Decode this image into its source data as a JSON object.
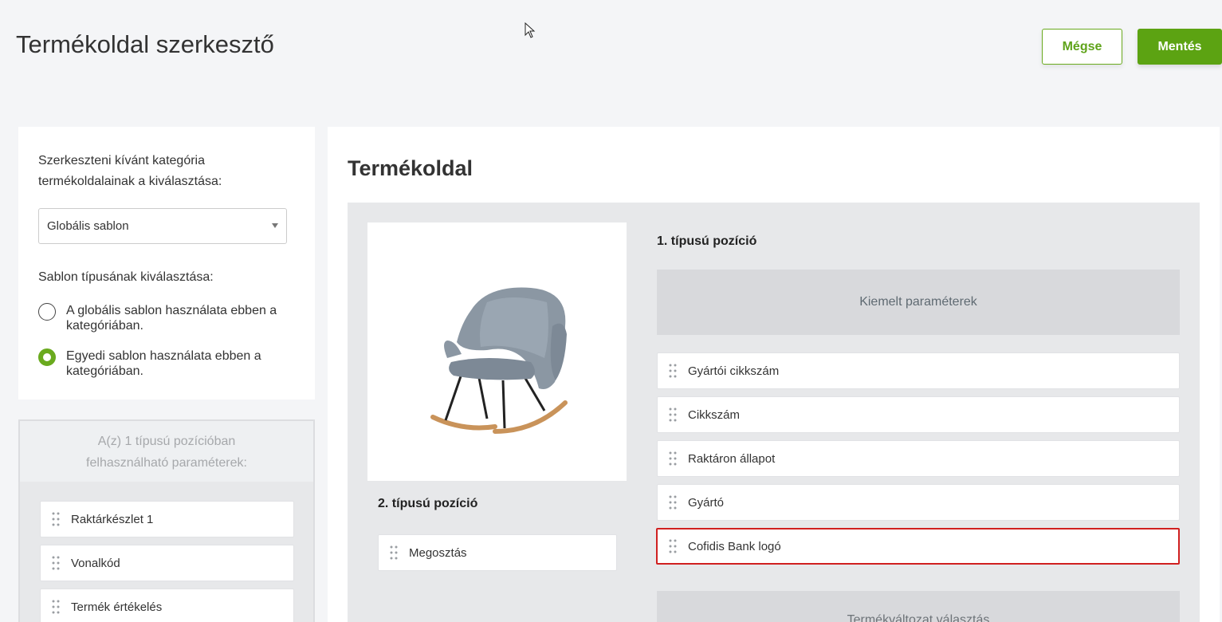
{
  "header": {
    "title": "Termékoldal szerkesztő",
    "cancel_label": "Mégse",
    "save_label": "Mentés"
  },
  "left_panel": {
    "category_label": "Szerkeszteni kívánt kategória termékoldalainak a kiválasztása:",
    "category_select_value": "Globális sablon",
    "template_type_label": "Sablon típusának kiválasztása:",
    "radio_options": [
      {
        "label": "A globális sablon használata ebben a kategóriában.",
        "checked": false
      },
      {
        "label": "Egyedi sablon használata ebben a kategóriában.",
        "checked": true
      }
    ],
    "params_heading": "A(z) 1 típusú pozícióban felhasználható paraméterek:",
    "params": [
      "Raktárkészlet 1",
      "Vonalkód",
      "Termék értékelés"
    ]
  },
  "right_panel": {
    "title": "Termékoldal",
    "position1_label": "1. típusú pozíció",
    "highlighted_params_label": "Kiemelt paraméterek",
    "position1_items": [
      "Gyártói cikkszám",
      "Cikkszám",
      "Raktáron állapot",
      "Gyártó",
      "Cofidis Bank logó"
    ],
    "position2_label": "2. típusú pozíció",
    "position2_items": [
      "Megosztás"
    ],
    "variant_label": "Termékváltozat választás"
  },
  "colors": {
    "accent_green": "#5ca312",
    "highlight_red": "#d02020"
  }
}
